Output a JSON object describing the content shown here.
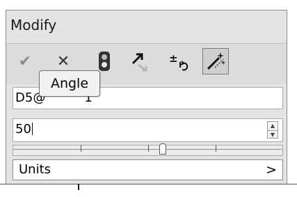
{
  "panel": {
    "title": "Modify"
  },
  "toolbar": {
    "buttons": [
      {
        "icon": "check-icon",
        "glyph": "✔",
        "color": "#8a8a8a"
      },
      {
        "icon": "close-icon",
        "glyph": "✕",
        "color": "#333333"
      },
      {
        "icon": "traffic-light-icon"
      },
      {
        "icon": "arrow-icon"
      },
      {
        "icon": "plus-minus-undo-icon"
      },
      {
        "icon": "magic-wand-icon",
        "active": true
      }
    ]
  },
  "tooltip": {
    "text": "Angle"
  },
  "fields": {
    "reference_value": "D5@",
    "reference_suffix": "1",
    "angle_value": "50"
  },
  "units": {
    "label": "Units",
    "chevron": ">"
  }
}
